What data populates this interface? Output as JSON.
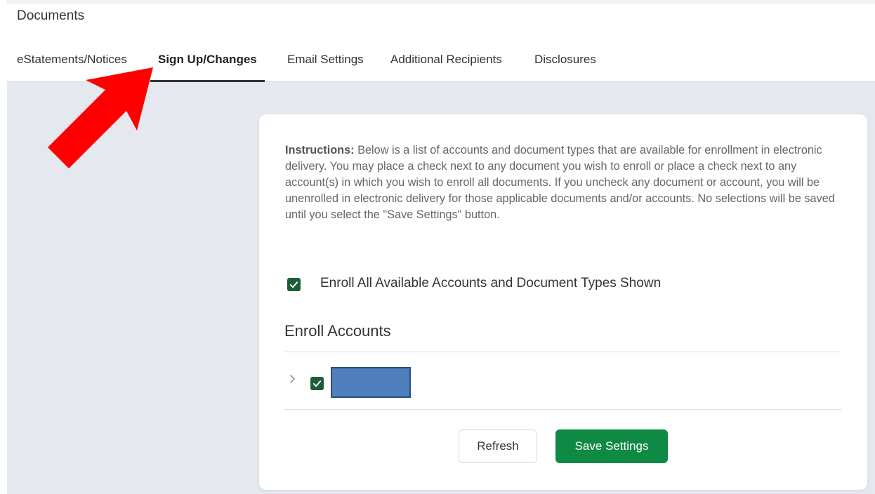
{
  "page": {
    "title": "Documents"
  },
  "tabs": [
    {
      "label": "eStatements/Notices",
      "active": false
    },
    {
      "label": "Sign Up/Changes",
      "active": true
    },
    {
      "label": "Email Settings",
      "active": false
    },
    {
      "label": "Additional Recipients",
      "active": false
    },
    {
      "label": "Disclosures",
      "active": false
    }
  ],
  "instructions": {
    "lead": "Instructions:",
    "text": " Below is a list of accounts and document types that are available for enrollment in electronic delivery. You may place a check next to any document you wish to enroll or place a check next to any account(s) in which you wish to enroll all documents. If you uncheck any document or account, you will be unenrolled in electronic delivery for those applicable documents and/or accounts. No selections will be saved until you select the \"Save Settings\" button."
  },
  "enroll_all": {
    "label": "Enroll All Available Accounts and Document Types Shown",
    "checked": true
  },
  "enroll_accounts": {
    "title": "Enroll Accounts",
    "accounts": [
      {
        "checked": true,
        "expanded": false,
        "redacted": true
      }
    ]
  },
  "buttons": {
    "refresh": "Refresh",
    "save": "Save Settings"
  },
  "colors": {
    "accent_green": "#0f8a45",
    "checkbox_green": "#1e5c3a",
    "annotation_arrow": "#ff0000",
    "redaction_fill": "#4f7fbd"
  },
  "icons": {
    "checkbox": "checkmark-icon",
    "expand": "chevron-right-icon",
    "annotation": "red-arrow-annotation"
  }
}
